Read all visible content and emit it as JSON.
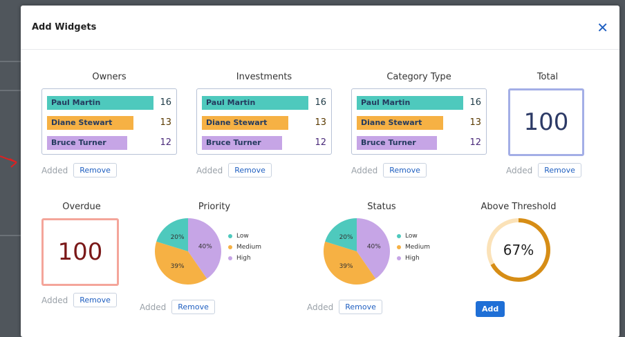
{
  "modal": {
    "title": "Add Widgets",
    "close_icon": "close-icon",
    "close_glyph": "✕"
  },
  "colors": {
    "teal": "#4ec9bd",
    "orange": "#f6b144",
    "purple": "#c6a5e6",
    "total_border": "#a3aee6",
    "total_text": "#2c3a66",
    "overdue_border": "#f4a59a",
    "overdue_text": "#7a1818",
    "gauge": "#d68d16",
    "gauge_track": "#fbe2b8",
    "accent": "#1f6fd6"
  },
  "widgets": {
    "owners": {
      "title": "Owners",
      "rows": [
        {
          "name": "Paul Martin",
          "value": "16",
          "color": "#4ec9bd",
          "ratio": 1.0
        },
        {
          "name": "Diane Stewart",
          "value": "13",
          "color": "#f6b144",
          "ratio": 0.81
        },
        {
          "name": "Bruce Turner",
          "value": "12",
          "color": "#c6a5e6",
          "ratio": 0.75
        }
      ],
      "status": "Added",
      "action": "Remove"
    },
    "investments": {
      "title": "Investments",
      "rows": [
        {
          "name": "Paul Martin",
          "value": "16",
          "color": "#4ec9bd",
          "ratio": 1.0
        },
        {
          "name": "Diane Stewart",
          "value": "13",
          "color": "#f6b144",
          "ratio": 0.81
        },
        {
          "name": "Bruce Turner",
          "value": "12",
          "color": "#c6a5e6",
          "ratio": 0.75
        }
      ],
      "status": "Added",
      "action": "Remove"
    },
    "category_type": {
      "title": "Category Type",
      "rows": [
        {
          "name": "Paul Martin",
          "value": "16",
          "color": "#4ec9bd",
          "ratio": 1.0
        },
        {
          "name": "Diane Stewart",
          "value": "13",
          "color": "#f6b144",
          "ratio": 0.81
        },
        {
          "name": "Bruce Turner",
          "value": "12",
          "color": "#c6a5e6",
          "ratio": 0.75
        }
      ],
      "status": "Added",
      "action": "Remove"
    },
    "total": {
      "title": "Total",
      "value": "100",
      "status": "Added",
      "action": "Remove"
    },
    "overdue": {
      "title": "Overdue",
      "value": "100",
      "status": "Added",
      "action": "Remove"
    },
    "priority": {
      "title": "Priority",
      "legend": [
        "Low",
        "Medium",
        "High"
      ],
      "status": "Added",
      "action": "Remove"
    },
    "status_widget": {
      "title": "Status",
      "legend": [
        "Low",
        "Medium",
        "High"
      ],
      "status": "Added",
      "action": "Remove"
    },
    "above_threshold": {
      "title": "Above Threshold",
      "value": "67%",
      "fraction": 0.67,
      "action": "Add"
    }
  },
  "chart_data": [
    {
      "type": "pie",
      "title": "Priority",
      "categories": [
        "Low",
        "Medium",
        "High"
      ],
      "values": [
        20,
        39,
        40
      ],
      "labels": [
        "20%",
        "39%",
        "40%"
      ],
      "colors": [
        "#4ec9bd",
        "#f6b144",
        "#c6a5e6"
      ]
    },
    {
      "type": "pie",
      "title": "Status",
      "categories": [
        "Low",
        "Medium",
        "High"
      ],
      "values": [
        20,
        39,
        40
      ],
      "labels": [
        "20%",
        "39%",
        "40%"
      ],
      "colors": [
        "#4ec9bd",
        "#f6b144",
        "#c6a5e6"
      ]
    }
  ]
}
